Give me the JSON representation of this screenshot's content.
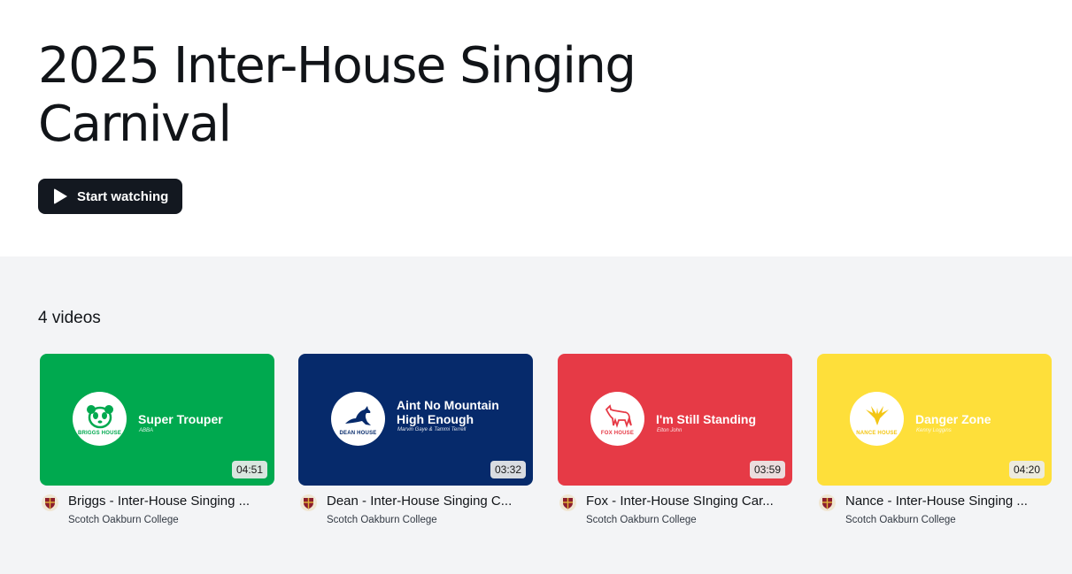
{
  "hero": {
    "title": "2025 Inter-House Singing Carnival",
    "start_button": "Start watching"
  },
  "list": {
    "count_label": "4 videos"
  },
  "videos": [
    {
      "house_label": "BRIGGS HOUSE",
      "song": "Super Trouper",
      "artist": "ABBA",
      "duration": "04:51",
      "title": "Briggs - Inter-House Singing ...",
      "channel": "Scotch Oakburn College",
      "color": "#00a94f",
      "crest_icon": "panda-icon"
    },
    {
      "house_label": "DEAN HOUSE",
      "song": "Aint No Mountain High Enough",
      "artist": "Marvin Gaye & Tammi Terrell",
      "duration": "03:32",
      "title": "Dean - Inter-House Singing C...",
      "channel": "Scotch Oakburn College",
      "color": "#062a6b",
      "crest_icon": "kangaroo-icon"
    },
    {
      "house_label": "FOX HOUSE",
      "song": "I'm Still Standing",
      "artist": "Elton John",
      "duration": "03:59",
      "title": "Fox - Inter-House SInging Car...",
      "channel": "Scotch Oakburn College",
      "color": "#e63a46",
      "crest_icon": "fox-icon"
    },
    {
      "house_label": "NANCE HOUSE",
      "song": "Danger Zone",
      "artist": "Kenny Loggins",
      "duration": "04:20",
      "title": "Nance - Inter-House Singing ...",
      "channel": "Scotch Oakburn College",
      "color": "#fedf3a",
      "crest_icon": "eagle-icon"
    }
  ]
}
